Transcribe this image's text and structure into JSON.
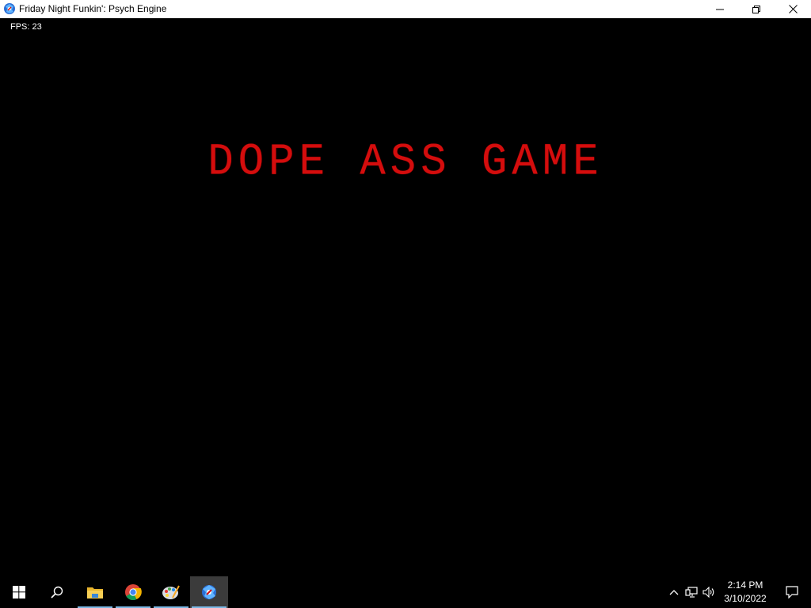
{
  "window": {
    "title": "Friday Night Funkin': Psych Engine",
    "icon": "fnf-app-icon",
    "controls": [
      "minimize-icon",
      "restore-icon",
      "close-icon"
    ]
  },
  "game": {
    "fps_text": "FPS: 23",
    "headline": "DOPE ASS GAME",
    "headline_color": "#d40d0d",
    "background_color": "#000000"
  },
  "taskbar": {
    "buttons": [
      {
        "name": "start-button",
        "icon": "windows-logo-icon"
      },
      {
        "name": "search-button",
        "icon": "search-icon"
      },
      {
        "name": "file-explorer-button",
        "icon": "folder-icon",
        "running": true
      },
      {
        "name": "chrome-button",
        "icon": "chrome-icon",
        "running": true
      },
      {
        "name": "paint-button",
        "icon": "palette-icon",
        "running": true
      },
      {
        "name": "fnf-button",
        "icon": "fnf-app-icon",
        "running": true,
        "active": true
      }
    ],
    "tray": {
      "icons": [
        "chevron-up-icon",
        "network-icon",
        "volume-icon"
      ],
      "time": "2:14 PM",
      "date": "3/10/2022",
      "notification_icon": "notification-icon"
    },
    "accent_color": "#7ab7e3"
  }
}
